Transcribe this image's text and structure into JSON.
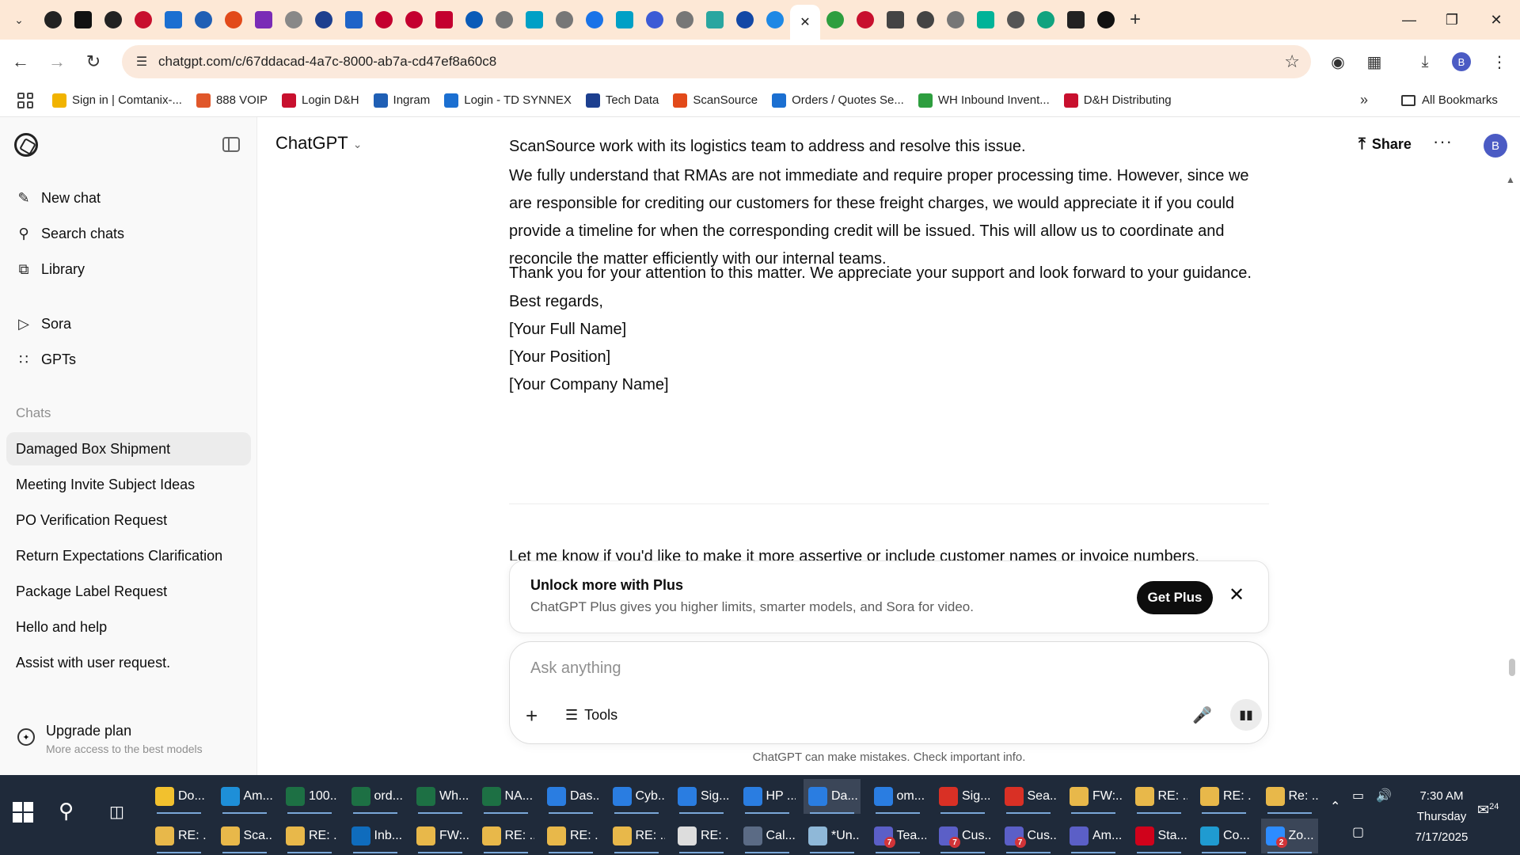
{
  "browser": {
    "url": "chatgpt.com/c/67ddacad-4a7c-8000-ab7a-cd47ef8a60c8",
    "tabs": [
      {
        "icon": "amazon-tab-icon",
        "color": "#222222"
      },
      {
        "icon": "amazon-square-tab-icon",
        "color": "#111111"
      },
      {
        "icon": "amazon-tab-icon",
        "color": "#222222"
      },
      {
        "icon": "dh-tab-icon",
        "color": "#c8102e"
      },
      {
        "icon": "ec-tab-icon",
        "color": "#1b6fd1"
      },
      {
        "icon": "ingram-tab-icon",
        "color": "#1f5fb5"
      },
      {
        "icon": "scansource-tab-icon",
        "color": "#e24a1a"
      },
      {
        "icon": "drive-tab-icon",
        "color": "#7a2bb6"
      },
      {
        "icon": "globe-tab-icon",
        "color": "#888888"
      },
      {
        "icon": "etn-tab-icon",
        "color": "#1d3f8f"
      },
      {
        "icon": "f-tab-icon",
        "color": "#1e64c8"
      },
      {
        "icon": "lg-tab-icon",
        "color": "#c4002f"
      },
      {
        "icon": "lg-tab-icon",
        "color": "#c4002f"
      },
      {
        "icon": "lg-tab-icon",
        "color": "#c4002f"
      },
      {
        "icon": "hp-tab-icon",
        "color": "#0a5bb8"
      },
      {
        "icon": "globe-tab-icon",
        "color": "#777777"
      },
      {
        "icon": "synnex-tab-icon",
        "color": "#00a0c6"
      },
      {
        "icon": "globe-tab-icon",
        "color": "#777777"
      },
      {
        "icon": "o-tab-icon",
        "color": "#1a73e8"
      },
      {
        "icon": "synnex-tab-icon",
        "color": "#00a0c6"
      },
      {
        "icon": "copilot-tab-icon",
        "color": "#3c5bd6"
      },
      {
        "icon": "globe-tab-icon",
        "color": "#777777"
      },
      {
        "icon": "cursor-tab-icon",
        "color": "#2aa6a0"
      },
      {
        "icon": "u-tab-icon",
        "color": "#1348a6"
      },
      {
        "icon": "cloud-tab-icon",
        "color": "#1e88e5"
      },
      {
        "icon": "close-tab-icon",
        "color": "#222222",
        "active": true
      },
      {
        "icon": "plus-tab-icon",
        "color": "#2e9e3f"
      },
      {
        "icon": "dh-tab-icon",
        "color": "#c8102e"
      },
      {
        "icon": "crown-tab-icon",
        "color": "#444444"
      },
      {
        "icon": "crown-tab-icon",
        "color": "#444444"
      },
      {
        "icon": "globe-tab-icon",
        "color": "#777777"
      },
      {
        "icon": "logi-tab-icon",
        "color": "#00b398"
      },
      {
        "icon": "car-tab-icon",
        "color": "#555555"
      },
      {
        "icon": "openai-tab-icon",
        "color": "#10a37f"
      },
      {
        "icon": "amazon-tab-icon",
        "color": "#222222"
      },
      {
        "icon": "amazon-square-tab-icon",
        "color": "#111111"
      }
    ],
    "bookmarks": [
      {
        "label": "Sign in | Comtanix-...",
        "color": "#f1b300"
      },
      {
        "label": "888 VOIP",
        "color": "#e0572a"
      },
      {
        "label": "Login D&H",
        "color": "#c8102e"
      },
      {
        "label": "Ingram",
        "color": "#1f5fb5"
      },
      {
        "label": "Login - TD SYNNEX",
        "color": "#1b6fd1"
      },
      {
        "label": "Tech Data",
        "color": "#1d3f8f"
      },
      {
        "label": "ScanSource",
        "color": "#e24a1a"
      },
      {
        "label": "Orders / Quotes Se...",
        "color": "#1b6fd1"
      },
      {
        "label": "WH Inbound Invent...",
        "color": "#2e9e3f"
      },
      {
        "label": "D&H Distributing",
        "color": "#c8102e"
      }
    ],
    "all_bookmarks": "All Bookmarks",
    "profile_initial": "B"
  },
  "sidebar": {
    "nav": [
      {
        "label": "New chat",
        "icon": "edit-icon"
      },
      {
        "label": "Search chats",
        "icon": "search-icon"
      },
      {
        "label": "Library",
        "icon": "library-icon"
      }
    ],
    "apps": [
      {
        "label": "Sora",
        "icon": "play-icon"
      },
      {
        "label": "GPTs",
        "icon": "grid-icon"
      }
    ],
    "chats_label": "Chats",
    "chats": [
      {
        "label": "Damaged Box Shipment",
        "active": true
      },
      {
        "label": "Meeting Invite Subject Ideas"
      },
      {
        "label": "PO Verification Request"
      },
      {
        "label": "Return Expectations Clarification"
      },
      {
        "label": "Package Label Request"
      },
      {
        "label": "Hello and help"
      },
      {
        "label": "Assist with user request."
      }
    ],
    "upgrade": {
      "title": "Upgrade plan",
      "subtitle": "More access to the best models"
    }
  },
  "main": {
    "model": "ChatGPT",
    "share_label": "Share",
    "avatar_initial": "B",
    "paragraphs": [
      "ScanSource work with its logistics team to address and resolve this issue.",
      "We fully understand that RMAs are not immediate and require proper processing time. However, since we are responsible for crediting our customers for these freight charges, we would appreciate it if you could provide a timeline for when the corresponding credit will be issued. This will allow us to coordinate and reconcile the matter efficiently with our internal teams.",
      "Thank you for your attention to this matter. We appreciate your support and look forward to your guidance."
    ],
    "signoff": [
      "Best regards,",
      "[Your Full Name]",
      "[Your Position]",
      "[Your Company Name]"
    ],
    "followup": "Let me know if you'd like to make it more assertive or include customer names or invoice numbers.",
    "plus_banner": {
      "title": "Unlock more with Plus",
      "subtitle": "ChatGPT Plus gives you higher limits, smarter models, and Sora for video.",
      "cta": "Get Plus"
    },
    "composer": {
      "placeholder": "Ask anything",
      "tools_label": "Tools"
    },
    "disclaimer": "ChatGPT can make mistakes. Check important info."
  },
  "taskbar": {
    "row1": [
      {
        "label": "Do...",
        "icon": "folder-icon",
        "color": "#f2c12e"
      },
      {
        "label": "Am...",
        "icon": "edge-icon",
        "color": "#1e8fd8"
      },
      {
        "label": "100...",
        "icon": "excel-icon",
        "color": "#1d7044"
      },
      {
        "label": "ord...",
        "icon": "excel-icon",
        "color": "#1d7044"
      },
      {
        "label": "Wh...",
        "icon": "excel-icon",
        "color": "#1d7044"
      },
      {
        "label": "NA...",
        "icon": "excel-icon",
        "color": "#1d7044"
      },
      {
        "label": "Das...",
        "icon": "chrome-icon",
        "color": "#2a7de1"
      },
      {
        "label": "Cyb...",
        "icon": "chrome-icon",
        "color": "#2a7de1"
      },
      {
        "label": "Sig...",
        "icon": "chrome-icon",
        "color": "#2a7de1"
      },
      {
        "label": "HP ...",
        "icon": "chrome-icon",
        "color": "#2a7de1"
      },
      {
        "label": "Da...",
        "icon": "chrome-icon",
        "color": "#2a7de1",
        "active": true
      },
      {
        "label": "om...",
        "icon": "chrome-icon",
        "color": "#2a7de1"
      },
      {
        "label": "Sig...",
        "icon": "chrome-icon",
        "color": "#d93025"
      },
      {
        "label": "Sea...",
        "icon": "chrome-icon",
        "color": "#d93025"
      },
      {
        "label": "FW:...",
        "icon": "mail-icon",
        "color": "#e8b84a"
      },
      {
        "label": "RE: ...",
        "icon": "mail-icon",
        "color": "#e8b84a"
      },
      {
        "label": "RE: ...",
        "icon": "mail-icon",
        "color": "#e8b84a"
      },
      {
        "label": "Re: ...",
        "icon": "mail-icon",
        "color": "#e8b84a"
      }
    ],
    "row2": [
      {
        "label": "RE: ...",
        "icon": "mail-icon",
        "color": "#e8b84a"
      },
      {
        "label": "Sca...",
        "icon": "mail-icon",
        "color": "#e8b84a"
      },
      {
        "label": "RE: ...",
        "icon": "mail-icon",
        "color": "#e8b84a"
      },
      {
        "label": "Inb...",
        "icon": "outlook-icon",
        "color": "#0f6cbd"
      },
      {
        "label": "FW:...",
        "icon": "mail-icon",
        "color": "#e8b84a"
      },
      {
        "label": "RE: ...",
        "icon": "mail-icon",
        "color": "#e8b84a"
      },
      {
        "label": "RE: ...",
        "icon": "mail-icon",
        "color": "#e8b84a"
      },
      {
        "label": "RE: ...",
        "icon": "mail-icon",
        "color": "#e8b84a"
      },
      {
        "label": "RE: ...",
        "icon": "mail-dark-icon",
        "color": "#dddddd"
      },
      {
        "label": "Cal...",
        "icon": "calculator-icon",
        "color": "#5b6b85"
      },
      {
        "label": "*Un...",
        "icon": "notepad-icon",
        "color": "#8fb8d8"
      },
      {
        "label": "Tea...",
        "icon": "teams-icon",
        "color": "#5b5fc7",
        "badge": "7"
      },
      {
        "label": "Cus...",
        "icon": "teams-icon",
        "color": "#5b5fc7",
        "badge": "7"
      },
      {
        "label": "Cus...",
        "icon": "teams-icon",
        "color": "#5b5fc7",
        "badge": "7"
      },
      {
        "label": "Am...",
        "icon": "teams-icon",
        "color": "#5b5fc7"
      },
      {
        "label": "Sta...",
        "icon": "pdf-icon",
        "color": "#d0021b"
      },
      {
        "label": "Co...",
        "icon": "app-icon",
        "color": "#1f9bd1"
      },
      {
        "label": "Zo...",
        "icon": "zoom-icon",
        "color": "#2d8cff",
        "badge": "2",
        "active": true
      }
    ],
    "clock": {
      "time": "7:30 AM",
      "day": "Thursday",
      "date": "7/17/2025"
    },
    "notification_count": "24"
  }
}
